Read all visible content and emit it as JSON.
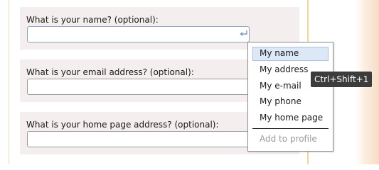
{
  "form": {
    "fields": [
      {
        "label": "What is your name? (optional):",
        "value": "",
        "has_enter_icon": true
      },
      {
        "label": "What is your email address? (optional):",
        "value": ""
      },
      {
        "label": "What is your home page address? (optional):",
        "value": ""
      }
    ]
  },
  "autofill_menu": {
    "items": [
      {
        "label": "My name",
        "selected": true
      },
      {
        "label": "My address"
      },
      {
        "label": "My e-mail"
      },
      {
        "label": "My phone"
      },
      {
        "label": "My home page"
      }
    ],
    "footer_item": {
      "label": "Add to profile",
      "disabled": true
    }
  },
  "tooltip": {
    "text": "Ctrl+Shift+1"
  },
  "icons": {
    "enter": "enter-key-icon"
  },
  "colors": {
    "field_background": "#f4eeee",
    "selected_item": "#dde8f6",
    "tooltip_background": "#3c3c3c",
    "page_border": "#f0d890"
  }
}
